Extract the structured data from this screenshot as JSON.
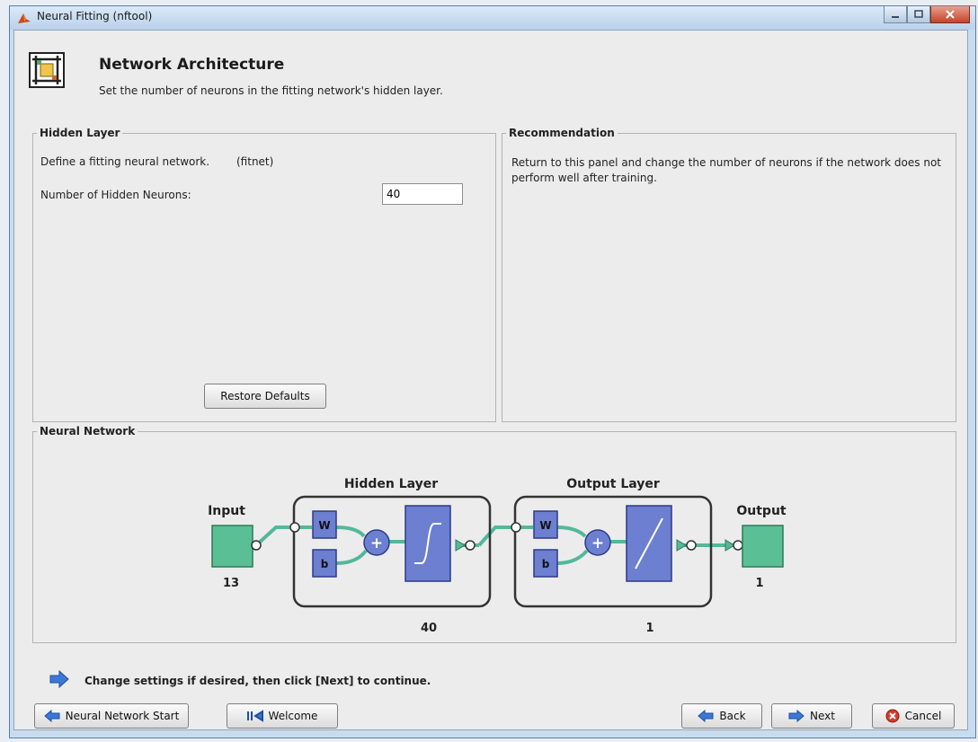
{
  "window": {
    "title": "Neural Fitting (nftool)",
    "controls": [
      "minimize-icon",
      "maximize-icon",
      "close-icon"
    ]
  },
  "header": {
    "title": "Network Architecture",
    "subtitle": "Set the number of neurons in the fitting network's hidden layer."
  },
  "hidden_layer_panel": {
    "title": "Hidden Layer",
    "description": "Define a fitting neural network.",
    "function_name": "(fitnet)",
    "neurons_label": "Number of Hidden Neurons:",
    "neurons_value": "40",
    "restore_button": "Restore Defaults"
  },
  "recommendation_panel": {
    "title": "Recommendation",
    "text": "Return to this panel and change the number of neurons if the network does not perform well after training."
  },
  "network_panel": {
    "title": "Neural Network",
    "input_label": "Input",
    "input_size": "13",
    "hidden_layer_label": "Hidden Layer",
    "hidden_size": "40",
    "output_layer_label": "Output Layer",
    "output_layer_size": "1",
    "output_label": "Output",
    "output_size": "1",
    "weight_label": "W",
    "bias_label": "b",
    "sum_label": "+"
  },
  "footer": {
    "message": "Change settings  if desired, then click [Next] to continue.",
    "buttons": {
      "start": "Neural Network Start",
      "welcome": "Welcome",
      "back": "Back",
      "next": "Next",
      "cancel": "Cancel"
    }
  },
  "colors": {
    "block_green": "#5bbf95",
    "layer_blue": "#6c7fd0",
    "connector_green": "#53b89a"
  }
}
